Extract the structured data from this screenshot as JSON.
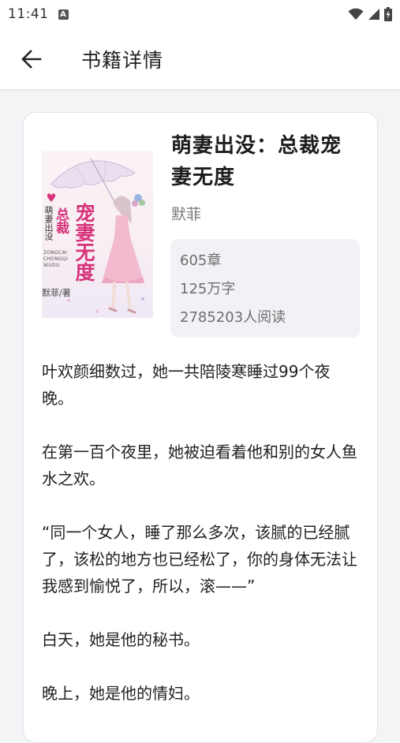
{
  "status_bar": {
    "time": "11:41",
    "notification_icon": "a-square-icon",
    "icons": [
      "wifi-icon",
      "signal-icon",
      "battery-charging-icon"
    ]
  },
  "app_bar": {
    "back_icon": "arrow-left-icon",
    "title": "书籍详情"
  },
  "book": {
    "cover": {
      "title_line_1": "宠妻无度",
      "title_line_2": "总裁",
      "title_line_3": "萌妻出没",
      "pinyin": "ZONGCAI CHONGQI WUDU",
      "author_mark": "默菲/著"
    },
    "title": "萌妻出没：总裁宠妻无度",
    "author": "默菲",
    "chapters": "605章",
    "word_count": "125万字",
    "readers": "2785203人阅读",
    "description": [
      "叶欢颜细数过，她一共陪陵寒睡过99个夜晚。",
      "在第一百个夜里，她被迫看着他和别的女人鱼水之欢。",
      "“同一个女人，睡了那么多次，该腻的已经腻了，该松的地方也已经松了，你的身体无法让我感到愉悦了，所以，滚——”",
      "白天，她是他的秘书。",
      "晚上，她是他的情妇。"
    ]
  },
  "colors": {
    "background": "#f3f4f6",
    "card": "#ffffff",
    "stats_box": "#f1f2f5",
    "cover_title": "#d6337a"
  }
}
